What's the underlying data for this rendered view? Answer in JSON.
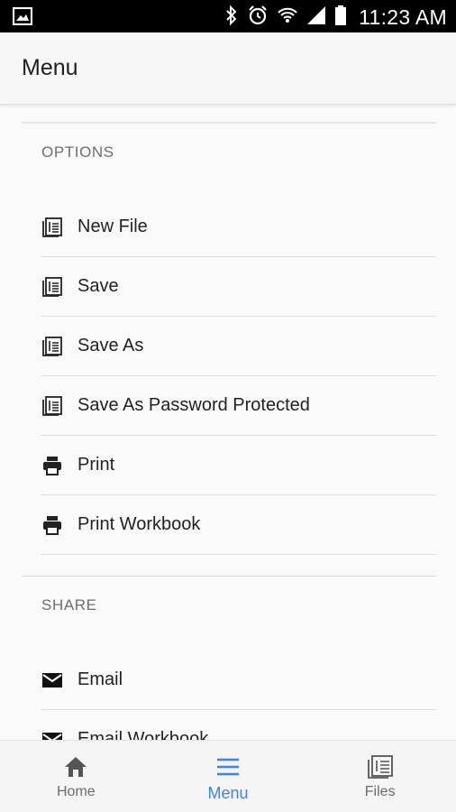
{
  "status_bar": {
    "time": "11:23 AM"
  },
  "header": {
    "title": "Menu"
  },
  "options": {
    "title": "OPTIONS",
    "items": [
      {
        "label": "New File",
        "icon": "book-icon"
      },
      {
        "label": "Save",
        "icon": "book-icon"
      },
      {
        "label": "Save As",
        "icon": "book-icon"
      },
      {
        "label": "Save As Password Protected",
        "icon": "book-icon"
      },
      {
        "label": "Print",
        "icon": "printer-icon"
      },
      {
        "label": "Print Workbook",
        "icon": "printer-icon"
      }
    ]
  },
  "share": {
    "title": "SHARE",
    "items": [
      {
        "label": "Email",
        "icon": "mail-icon"
      },
      {
        "label": "Email Workbook",
        "icon": "mail-icon"
      }
    ]
  },
  "bottom_nav": {
    "tabs": [
      {
        "label": "Home",
        "icon": "home-icon"
      },
      {
        "label": "Menu",
        "icon": "menu-icon",
        "active": true
      },
      {
        "label": "Files",
        "icon": "book-icon"
      }
    ]
  },
  "colors": {
    "accent": "#3b82f6",
    "status_bar": "#000000",
    "background": "#fafafa"
  }
}
